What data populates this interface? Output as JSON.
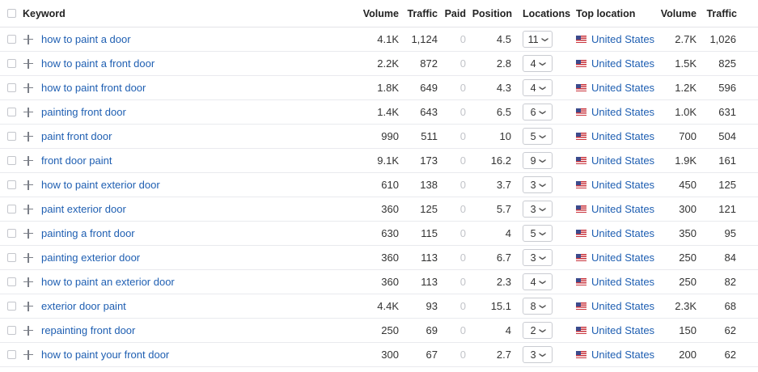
{
  "header": {
    "keyword": "Keyword",
    "volume": "Volume",
    "traffic": "Traffic",
    "paid": "Paid",
    "position": "Position",
    "locations": "Locations",
    "top_location": "Top location",
    "volume2": "Volume",
    "traffic2": "Traffic"
  },
  "icons": {
    "checkbox": "checkbox-icon",
    "add": "plus-icon",
    "chevron": "chevron-down-icon",
    "flag": "us-flag-icon"
  },
  "colors": {
    "link": "#1f5fb2",
    "muted": "#c2c4c9",
    "border": "#e9eaee"
  },
  "rows": [
    {
      "keyword": "how to paint a door",
      "volume": "4.1K",
      "traffic": "1,124",
      "paid": "0",
      "position": "4.5",
      "locations": "11",
      "top_location": "United States",
      "volume2": "2.7K",
      "traffic2": "1,026"
    },
    {
      "keyword": "how to paint a front door",
      "volume": "2.2K",
      "traffic": "872",
      "paid": "0",
      "position": "2.8",
      "locations": "4",
      "top_location": "United States",
      "volume2": "1.5K",
      "traffic2": "825"
    },
    {
      "keyword": "how to paint front door",
      "volume": "1.8K",
      "traffic": "649",
      "paid": "0",
      "position": "4.3",
      "locations": "4",
      "top_location": "United States",
      "volume2": "1.2K",
      "traffic2": "596"
    },
    {
      "keyword": "painting front door",
      "volume": "1.4K",
      "traffic": "643",
      "paid": "0",
      "position": "6.5",
      "locations": "6",
      "top_location": "United States",
      "volume2": "1.0K",
      "traffic2": "631"
    },
    {
      "keyword": "paint front door",
      "volume": "990",
      "traffic": "511",
      "paid": "0",
      "position": "10",
      "locations": "5",
      "top_location": "United States",
      "volume2": "700",
      "traffic2": "504"
    },
    {
      "keyword": "front door paint",
      "volume": "9.1K",
      "traffic": "173",
      "paid": "0",
      "position": "16.2",
      "locations": "9",
      "top_location": "United States",
      "volume2": "1.9K",
      "traffic2": "161"
    },
    {
      "keyword": "how to paint exterior door",
      "volume": "610",
      "traffic": "138",
      "paid": "0",
      "position": "3.7",
      "locations": "3",
      "top_location": "United States",
      "volume2": "450",
      "traffic2": "125"
    },
    {
      "keyword": "paint exterior door",
      "volume": "360",
      "traffic": "125",
      "paid": "0",
      "position": "5.7",
      "locations": "3",
      "top_location": "United States",
      "volume2": "300",
      "traffic2": "121"
    },
    {
      "keyword": "painting a front door",
      "volume": "630",
      "traffic": "115",
      "paid": "0",
      "position": "4",
      "locations": "5",
      "top_location": "United States",
      "volume2": "350",
      "traffic2": "95"
    },
    {
      "keyword": "painting exterior door",
      "volume": "360",
      "traffic": "113",
      "paid": "0",
      "position": "6.7",
      "locations": "3",
      "top_location": "United States",
      "volume2": "250",
      "traffic2": "84"
    },
    {
      "keyword": "how to paint an exterior door",
      "volume": "360",
      "traffic": "113",
      "paid": "0",
      "position": "2.3",
      "locations": "4",
      "top_location": "United States",
      "volume2": "250",
      "traffic2": "82"
    },
    {
      "keyword": "exterior door paint",
      "volume": "4.4K",
      "traffic": "93",
      "paid": "0",
      "position": "15.1",
      "locations": "8",
      "top_location": "United States",
      "volume2": "2.3K",
      "traffic2": "68"
    },
    {
      "keyword": "repainting front door",
      "volume": "250",
      "traffic": "69",
      "paid": "0",
      "position": "4",
      "locations": "2",
      "top_location": "United States",
      "volume2": "150",
      "traffic2": "62"
    },
    {
      "keyword": "how to paint your front door",
      "volume": "300",
      "traffic": "67",
      "paid": "0",
      "position": "2.7",
      "locations": "3",
      "top_location": "United States",
      "volume2": "200",
      "traffic2": "62"
    }
  ]
}
